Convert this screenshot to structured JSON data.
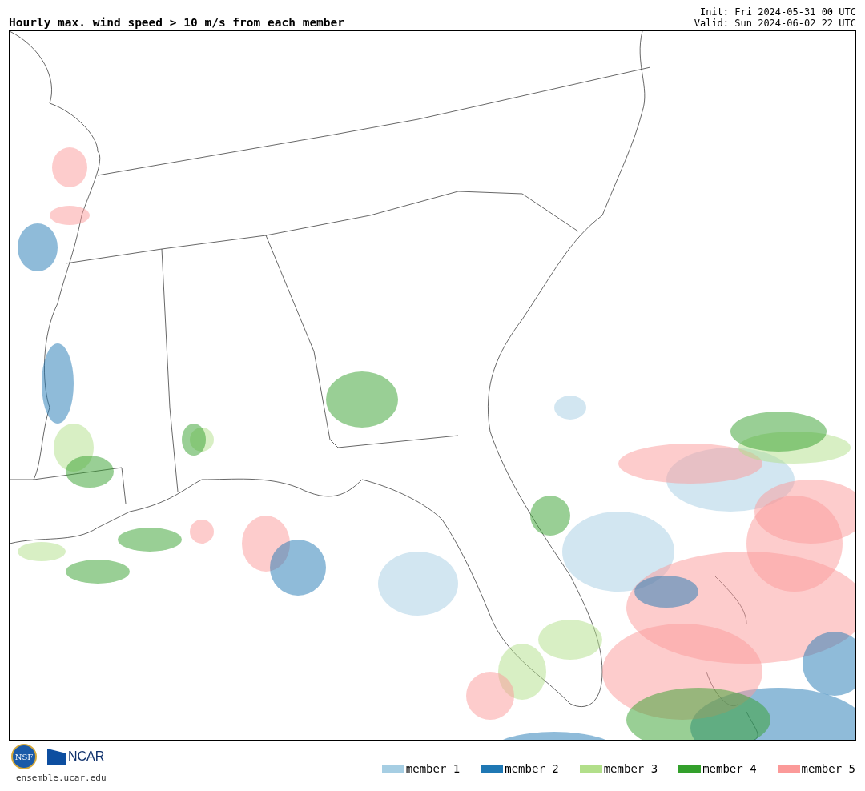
{
  "title": "Hourly max. wind speed > 10 m/s from each member",
  "init": "Init: Fri 2024-05-31 00 UTC",
  "valid": "Valid: Sun 2024-06-02 22 UTC",
  "logos": {
    "nsf": "NSF",
    "ncar": "NCAR"
  },
  "site": "ensemble.ucar.edu",
  "legend": [
    {
      "label": "member 1",
      "color": "#a6cee3"
    },
    {
      "label": "member 2",
      "color": "#1f78b4"
    },
    {
      "label": "member 3",
      "color": "#b2df8a"
    },
    {
      "label": "member 4",
      "color": "#33a02c"
    },
    {
      "label": "member 5",
      "color": "#fb9a99"
    }
  ]
}
